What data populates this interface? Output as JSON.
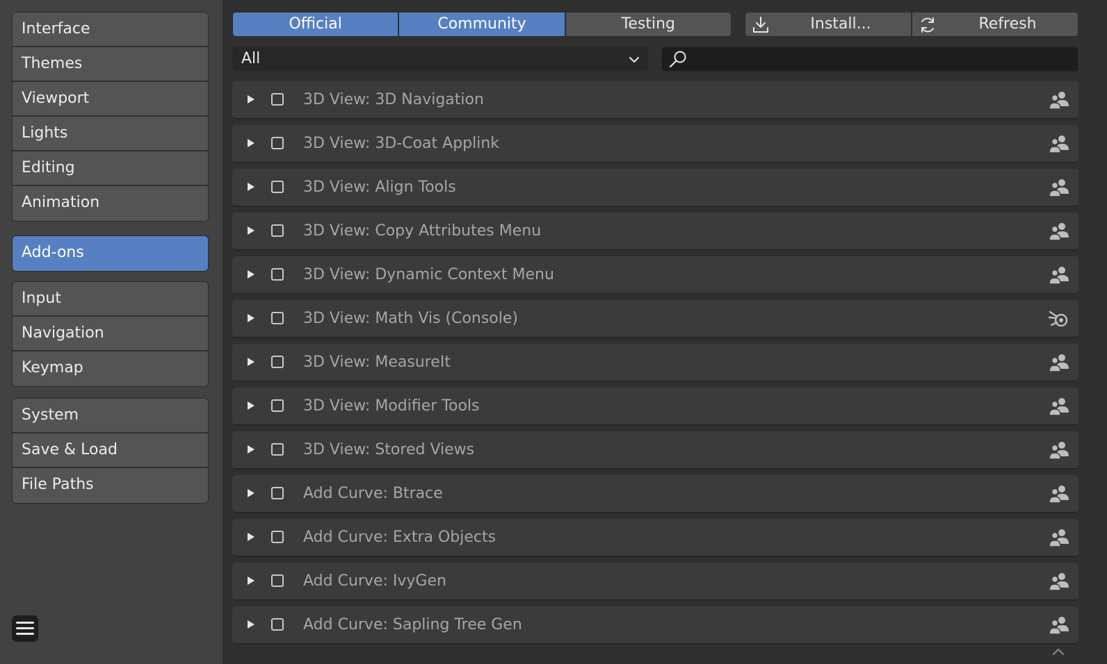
{
  "sidebar": {
    "groups": [
      [
        {
          "label": "Interface",
          "active": false
        },
        {
          "label": "Themes",
          "active": false
        },
        {
          "label": "Viewport",
          "active": false
        },
        {
          "label": "Lights",
          "active": false
        },
        {
          "label": "Editing",
          "active": false
        },
        {
          "label": "Animation",
          "active": false
        }
      ],
      [
        {
          "label": "Add-ons",
          "active": true
        }
      ],
      [
        {
          "label": "Input",
          "active": false
        },
        {
          "label": "Navigation",
          "active": false
        },
        {
          "label": "Keymap",
          "active": false
        }
      ],
      [
        {
          "label": "System",
          "active": false
        },
        {
          "label": "Save & Load",
          "active": false
        },
        {
          "label": "File Paths",
          "active": false
        }
      ]
    ],
    "menu_icon": "hamburger-menu-icon"
  },
  "tabs": [
    {
      "label": "Official",
      "active": true
    },
    {
      "label": "Community",
      "active": true
    },
    {
      "label": "Testing",
      "active": false
    }
  ],
  "actions": {
    "install_label": "Install...",
    "install_icon": "download-icon",
    "refresh_label": "Refresh",
    "refresh_icon": "refresh-icon"
  },
  "filter": {
    "category_value": "All",
    "search_value": "",
    "search_placeholder": ""
  },
  "addons": [
    {
      "name": "3D View: 3D Navigation",
      "support": "community"
    },
    {
      "name": "3D View: 3D-Coat Applink",
      "support": "community"
    },
    {
      "name": "3D View: Align Tools",
      "support": "community"
    },
    {
      "name": "3D View: Copy Attributes Menu",
      "support": "community"
    },
    {
      "name": "3D View: Dynamic Context Menu",
      "support": "community"
    },
    {
      "name": "3D View: Math Vis (Console)",
      "support": "official"
    },
    {
      "name": "3D View: MeasureIt",
      "support": "community"
    },
    {
      "name": "3D View: Modifier Tools",
      "support": "community"
    },
    {
      "name": "3D View: Stored Views",
      "support": "community"
    },
    {
      "name": "Add Curve: Btrace",
      "support": "community"
    },
    {
      "name": "Add Curve: Extra Objects",
      "support": "community"
    },
    {
      "name": "Add Curve: IvyGen",
      "support": "community"
    },
    {
      "name": "Add Curve: Sapling Tree Gen",
      "support": "community"
    }
  ],
  "colors": {
    "accent": "#5680c2",
    "sidebar_bg": "#424242",
    "main_bg": "#303030",
    "row_bg": "#3b3b3b",
    "button_bg": "#545454"
  }
}
